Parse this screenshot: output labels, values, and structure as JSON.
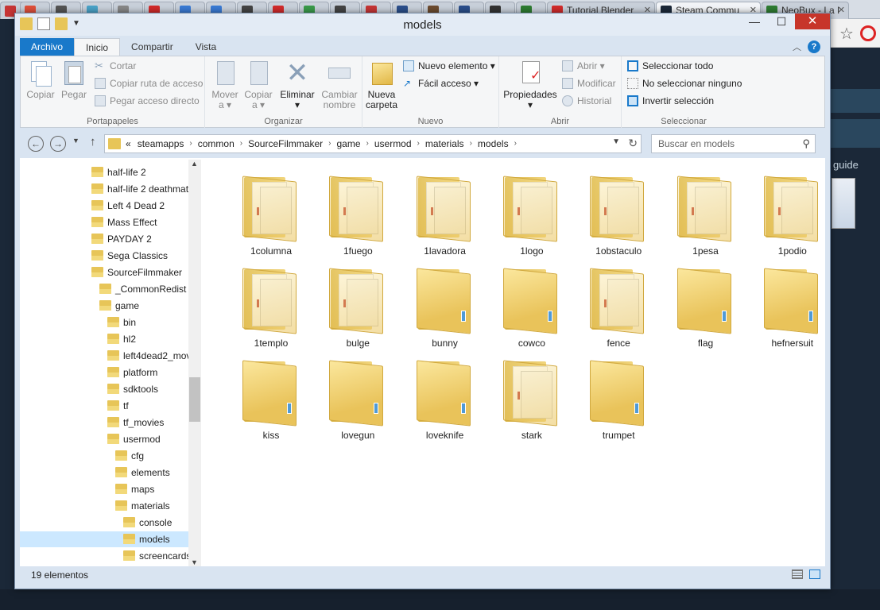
{
  "browser": {
    "tabs": [
      {
        "label": "",
        "color": "#c73535"
      },
      {
        "label": "",
        "color": "#e0503a"
      },
      {
        "label": "",
        "color": "#555555"
      },
      {
        "label": "",
        "color": "#4aa3c8"
      },
      {
        "label": "",
        "color": "#888888"
      },
      {
        "label": "",
        "color": "#d22b2b"
      },
      {
        "label": "",
        "color": "#3a7bd5"
      },
      {
        "label": "",
        "color": "#3a7bd5"
      },
      {
        "label": "",
        "color": "#444444"
      },
      {
        "label": "",
        "color": "#d22b2b"
      },
      {
        "label": "",
        "color": "#3a9b4a"
      },
      {
        "label": "",
        "color": "#444444"
      },
      {
        "label": "",
        "color": "#c73535"
      },
      {
        "label": "",
        "color": "#2b4f8c"
      },
      {
        "label": "",
        "color": "#6d4c30"
      },
      {
        "label": "",
        "color": "#2b4f8c"
      },
      {
        "label": "",
        "color": "#333333"
      },
      {
        "label": "",
        "color": "#2e7d32"
      },
      {
        "label": "Tutorial Blender",
        "color": "#d22b2b"
      },
      {
        "label": "Steam Commu",
        "color": "#1b2838"
      },
      {
        "label": "NeoBux - La I",
        "color": "#2e7d32"
      }
    ],
    "side_text": "guide"
  },
  "window": {
    "title": "models",
    "tabs": {
      "file": "Archivo",
      "home": "Inicio",
      "share": "Compartir",
      "view": "Vista"
    },
    "ribbon": {
      "portapapeles": {
        "label": "Portapapeles",
        "copy": "Copiar",
        "paste": "Pegar",
        "cut": "Cortar",
        "copy_path": "Copiar ruta de acceso",
        "paste_shortcut": "Pegar acceso directo"
      },
      "organizar": {
        "label": "Organizar",
        "move_1": "Mover",
        "move_2": "a",
        "copy_1": "Copiar",
        "copy_2": "a",
        "delete": "Eliminar",
        "rename_1": "Cambiar",
        "rename_2": "nombre"
      },
      "nuevo": {
        "label": "Nuevo",
        "new_folder_1": "Nueva",
        "new_folder_2": "carpeta",
        "new_item": "Nuevo elemento",
        "easy_access": "Fácil acceso"
      },
      "abrir": {
        "label": "Abrir",
        "properties": "Propiedades",
        "open": "Abrir",
        "edit": "Modificar",
        "history": "Historial"
      },
      "seleccionar": {
        "label": "Seleccionar",
        "select_all": "Seleccionar todo",
        "select_none": "No seleccionar ninguno",
        "invert": "Invertir selección"
      }
    },
    "breadcrumb": {
      "overflow": "«",
      "parts": [
        "steamapps",
        "common",
        "SourceFilmmaker",
        "game",
        "usermod",
        "materials",
        "models"
      ]
    },
    "search_placeholder": "Buscar en models",
    "tree": [
      {
        "label": "half-life 2",
        "level": 0
      },
      {
        "label": "half-life 2 deathmat",
        "level": 0
      },
      {
        "label": "Left 4 Dead 2",
        "level": 0
      },
      {
        "label": "Mass Effect",
        "level": 0
      },
      {
        "label": "PAYDAY 2",
        "level": 0
      },
      {
        "label": "Sega Classics",
        "level": 0
      },
      {
        "label": "SourceFilmmaker",
        "level": 0
      },
      {
        "label": "_CommonRedist",
        "level": 1
      },
      {
        "label": "game",
        "level": 1
      },
      {
        "label": "bin",
        "level": 2
      },
      {
        "label": "hl2",
        "level": 2
      },
      {
        "label": "left4dead2_mov",
        "level": 2
      },
      {
        "label": "platform",
        "level": 2
      },
      {
        "label": "sdktools",
        "level": 2
      },
      {
        "label": "tf",
        "level": 2
      },
      {
        "label": "tf_movies",
        "level": 2
      },
      {
        "label": "usermod",
        "level": 2
      },
      {
        "label": "cfg",
        "level": 3
      },
      {
        "label": "elements",
        "level": 3
      },
      {
        "label": "maps",
        "level": 3
      },
      {
        "label": "materials",
        "level": 3
      },
      {
        "label": "console",
        "level": 4
      },
      {
        "label": "models",
        "level": 4,
        "selected": true
      },
      {
        "label": "screencards",
        "level": 4
      }
    ],
    "files": [
      {
        "name": "1columna",
        "type": "papers"
      },
      {
        "name": "1fuego",
        "type": "papers"
      },
      {
        "name": "1lavadora",
        "type": "papers"
      },
      {
        "name": "1logo",
        "type": "papers"
      },
      {
        "name": "1obstaculo",
        "type": "papers"
      },
      {
        "name": "1pesa",
        "type": "papers"
      },
      {
        "name": "1podio",
        "type": "papers"
      },
      {
        "name": "1templo",
        "type": "papers"
      },
      {
        "name": "bulge",
        "type": "papers"
      },
      {
        "name": "bunny",
        "type": "plain"
      },
      {
        "name": "cowco",
        "type": "plain"
      },
      {
        "name": "fence",
        "type": "papers"
      },
      {
        "name": "flag",
        "type": "plain"
      },
      {
        "name": "hefnersuit",
        "type": "plain"
      },
      {
        "name": "kiss",
        "type": "plain"
      },
      {
        "name": "lovegun",
        "type": "plain"
      },
      {
        "name": "loveknife",
        "type": "plain"
      },
      {
        "name": "stark",
        "type": "papers"
      },
      {
        "name": "trumpet",
        "type": "plain"
      }
    ],
    "status": "19 elementos",
    "colors": {
      "accent": "#1979ca",
      "folder": "#e7c558",
      "selected": "#cce8ff"
    }
  }
}
